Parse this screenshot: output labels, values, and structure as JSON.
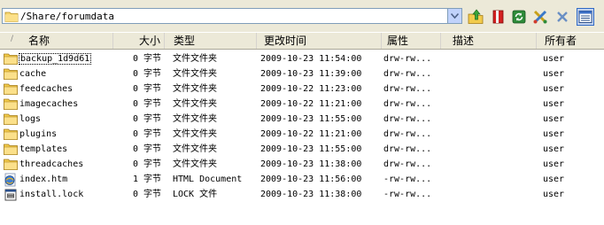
{
  "toolbar": {
    "path": "/Share/forumdata",
    "icons": [
      "folder-up-icon",
      "bookmark-icon",
      "refresh-icon",
      "tools-icon",
      "delete-icon",
      "view-details-icon"
    ]
  },
  "columns": {
    "name": "名称",
    "size": "大小",
    "type": "类型",
    "modified": "更改时间",
    "attributes": "属性",
    "description": "描述",
    "owner": "所有者"
  },
  "files": [
    {
      "name": "backup_1d9d61",
      "size": "0 字节",
      "type": "文件文件夹",
      "modified": "2009-10-23 11:54:00",
      "perm": "drw-rw...",
      "owner": "user",
      "icon": "folder-icon"
    },
    {
      "name": "cache",
      "size": "0 字节",
      "type": "文件文件夹",
      "modified": "2009-10-23 11:39:00",
      "perm": "drw-rw...",
      "owner": "user",
      "icon": "folder-icon"
    },
    {
      "name": "feedcaches",
      "size": "0 字节",
      "type": "文件文件夹",
      "modified": "2009-10-22 11:23:00",
      "perm": "drw-rw...",
      "owner": "user",
      "icon": "folder-icon"
    },
    {
      "name": "imagecaches",
      "size": "0 字节",
      "type": "文件文件夹",
      "modified": "2009-10-22 11:21:00",
      "perm": "drw-rw...",
      "owner": "user",
      "icon": "folder-icon"
    },
    {
      "name": "logs",
      "size": "0 字节",
      "type": "文件文件夹",
      "modified": "2009-10-23 11:55:00",
      "perm": "drw-rw...",
      "owner": "user",
      "icon": "folder-icon"
    },
    {
      "name": "plugins",
      "size": "0 字节",
      "type": "文件文件夹",
      "modified": "2009-10-22 11:21:00",
      "perm": "drw-rw...",
      "owner": "user",
      "icon": "folder-icon"
    },
    {
      "name": "templates",
      "size": "0 字节",
      "type": "文件文件夹",
      "modified": "2009-10-23 11:55:00",
      "perm": "drw-rw...",
      "owner": "user",
      "icon": "folder-icon"
    },
    {
      "name": "threadcaches",
      "size": "0 字节",
      "type": "文件文件夹",
      "modified": "2009-10-23 11:38:00",
      "perm": "drw-rw...",
      "owner": "user",
      "icon": "folder-icon"
    },
    {
      "name": "index.htm",
      "size": "1 字节",
      "type": "HTML Document",
      "modified": "2009-10-23 11:56:00",
      "perm": "-rw-rw...",
      "owner": "user",
      "icon": "html-file-icon"
    },
    {
      "name": "install.lock",
      "size": "0 字节",
      "type": "LOCK 文件",
      "modified": "2009-10-23 11:38:00",
      "perm": "-rw-rw...",
      "owner": "user",
      "icon": "lock-file-icon"
    }
  ]
}
